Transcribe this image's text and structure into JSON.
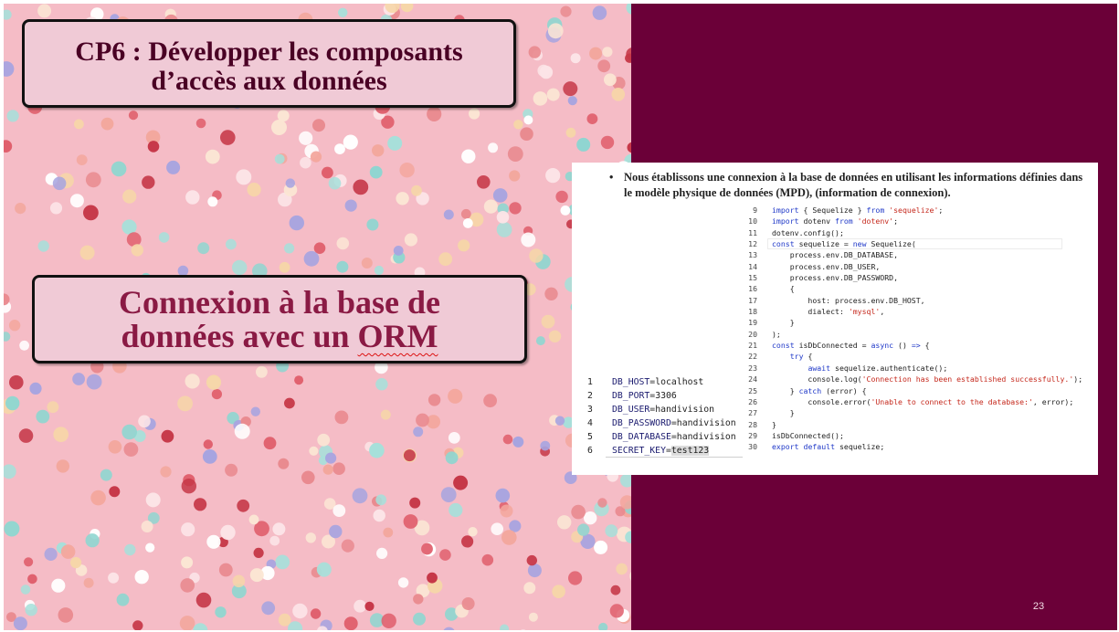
{
  "slide": {
    "title": {
      "line1": "CP6 : Développer les composants",
      "line2": "d’accès aux données"
    },
    "subtitle": {
      "line1": "Connexion à la base de",
      "line2_prefix": "données avec un ",
      "line2_word": "ORM"
    },
    "page_number": "23",
    "colors": {
      "background": "#6b0038",
      "title_box": "#f0cad6",
      "subtitle_text": "#8a1a44",
      "panel": "#f5bcc6"
    }
  },
  "content": {
    "intro": "Nous établissons une connexion à la base de données en utilisant les informations définies dans le modèle physique de données (MPD), (information de connexion).",
    "code_lines": [
      {
        "n": "9",
        "parts": [
          [
            "k",
            "import"
          ],
          [
            "p",
            " { Sequelize } "
          ],
          [
            "k",
            "from"
          ],
          [
            "p",
            " "
          ],
          [
            "s",
            "'sequelize'"
          ],
          [
            "p",
            ";"
          ]
        ]
      },
      {
        "n": "10",
        "parts": [
          [
            "k",
            "import"
          ],
          [
            "p",
            " dotenv "
          ],
          [
            "k",
            "from"
          ],
          [
            "p",
            " "
          ],
          [
            "s",
            "'dotenv'"
          ],
          [
            "p",
            ";"
          ]
        ]
      },
      {
        "n": "11",
        "parts": [
          [
            "p",
            "dotenv.config();"
          ]
        ]
      },
      {
        "n": "12",
        "parts": [
          [
            "k",
            "const"
          ],
          [
            "p",
            " sequelize = "
          ],
          [
            "k",
            "new"
          ],
          [
            "p",
            " Sequelize("
          ]
        ]
      },
      {
        "n": "13",
        "parts": [
          [
            "p",
            "    process.env.DB_DATABASE,"
          ]
        ]
      },
      {
        "n": "14",
        "parts": [
          [
            "p",
            "    process.env.DB_USER,"
          ]
        ]
      },
      {
        "n": "15",
        "parts": [
          [
            "p",
            "    process.env.DB_PASSWORD,"
          ]
        ]
      },
      {
        "n": "16",
        "parts": [
          [
            "p",
            "    {"
          ]
        ]
      },
      {
        "n": "17",
        "parts": [
          [
            "p",
            "        host: process.env.DB_HOST,"
          ]
        ]
      },
      {
        "n": "18",
        "parts": [
          [
            "p",
            "        dialect: "
          ],
          [
            "s",
            "'mysql'"
          ],
          [
            "p",
            ","
          ]
        ]
      },
      {
        "n": "19",
        "parts": [
          [
            "p",
            "    }"
          ]
        ]
      },
      {
        "n": "20",
        "parts": [
          [
            "p",
            ");"
          ]
        ]
      },
      {
        "n": "21",
        "parts": [
          [
            "k",
            "const"
          ],
          [
            "p",
            " isDbConnected = "
          ],
          [
            "k",
            "async"
          ],
          [
            "p",
            " () "
          ],
          [
            "k",
            "=>"
          ],
          [
            "p",
            " {"
          ]
        ]
      },
      {
        "n": "22",
        "parts": [
          [
            "p",
            "    "
          ],
          [
            "k",
            "try"
          ],
          [
            "p",
            " {"
          ]
        ]
      },
      {
        "n": "23",
        "parts": [
          [
            "p",
            "        "
          ],
          [
            "k",
            "await"
          ],
          [
            "p",
            " sequelize.authenticate();"
          ]
        ]
      },
      {
        "n": "24",
        "parts": [
          [
            "p",
            "        console.log("
          ],
          [
            "s",
            "'Connection has been established successfully.'"
          ],
          [
            "p",
            ");"
          ]
        ]
      },
      {
        "n": "25",
        "parts": [
          [
            "p",
            "    } "
          ],
          [
            "k",
            "catch"
          ],
          [
            "p",
            " (error) {"
          ]
        ]
      },
      {
        "n": "26",
        "parts": [
          [
            "p",
            "        console.error("
          ],
          [
            "s",
            "'Unable to connect to the database:'"
          ],
          [
            "p",
            ", error);"
          ]
        ]
      },
      {
        "n": "27",
        "parts": [
          [
            "p",
            "    }"
          ]
        ]
      },
      {
        "n": "28",
        "parts": [
          [
            "p",
            "}"
          ]
        ]
      },
      {
        "n": "29",
        "parts": [
          [
            "p",
            "isDbConnected();"
          ]
        ]
      },
      {
        "n": "30",
        "parts": [
          [
            "k",
            "export"
          ],
          [
            "p",
            " "
          ],
          [
            "k",
            "default"
          ],
          [
            "p",
            " sequelize;"
          ]
        ]
      }
    ],
    "env_lines": [
      {
        "n": "1",
        "key": "DB_HOST",
        "value": "localhost"
      },
      {
        "n": "2",
        "key": "DB_PORT",
        "value": "3306"
      },
      {
        "n": "3",
        "key": "DB_USER",
        "value": "handivision"
      },
      {
        "n": "4",
        "key": "DB_PASSWORD",
        "value": "handivision"
      },
      {
        "n": "5",
        "key": "DB_DATABASE",
        "value": "handivision"
      },
      {
        "n": "6",
        "key": "SECRET_KEY",
        "value": "test123"
      }
    ]
  }
}
